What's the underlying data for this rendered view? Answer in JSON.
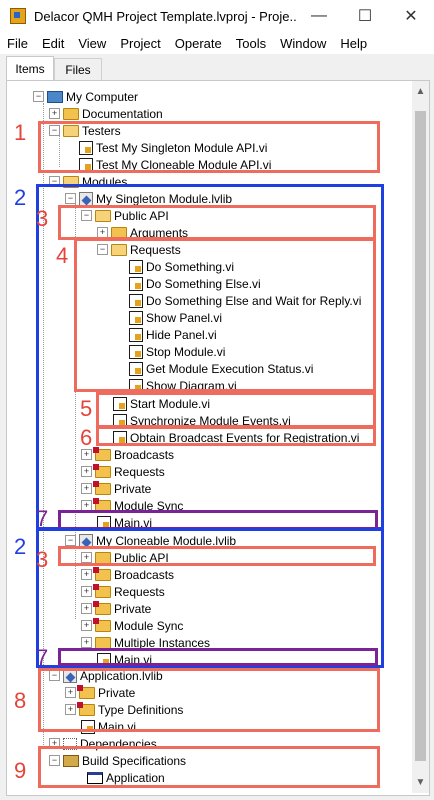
{
  "window": {
    "title": "Delacor QMH Project Template.lvproj - Proje...",
    "minimize": "—",
    "maximize": "☐",
    "close": "✕"
  },
  "menu": [
    "File",
    "Edit",
    "View",
    "Project",
    "Operate",
    "Tools",
    "Window",
    "Help"
  ],
  "tabs": {
    "items": "Items",
    "files": "Files"
  },
  "tree": {
    "my_computer": "My Computer",
    "documentation": "Documentation",
    "testers": "Testers",
    "test_singleton": "Test My Singleton Module API.vi",
    "test_cloneable": "Test My Cloneable Module API.vi",
    "modules": "Modules",
    "singleton_lib": "My Singleton Module.lvlib",
    "public_api": "Public API",
    "arguments": "Arguments",
    "requests_folder": "Requests",
    "do_something": "Do Something.vi",
    "do_something_else": "Do Something Else.vi",
    "do_something_else_wait": "Do Something Else and Wait for Reply.vi",
    "show_panel": "Show Panel.vi",
    "hide_panel": "Hide Panel.vi",
    "stop_module": "Stop Module.vi",
    "get_status": "Get Module Execution Status.vi",
    "show_diagram": "Show Diagram.vi",
    "start_module": "Start Module.vi",
    "sync_events": "Synchronize Module Events.vi",
    "obtain_broadcast": "Obtain Broadcast Events for Registration.vi",
    "broadcasts": "Broadcasts",
    "requests": "Requests",
    "private": "Private",
    "module_sync": "Module Sync",
    "main_vi": "Main.vi",
    "cloneable_lib": "My Cloneable Module.lvlib",
    "public_api2": "Public API",
    "broadcasts2": "Broadcasts",
    "requests2": "Requests",
    "private2": "Private",
    "module_sync2": "Module Sync",
    "multiple_instances": "Multiple Instances",
    "main_vi2": "Main.vi",
    "application_lib": "Application.lvlib",
    "private3": "Private",
    "type_definitions": "Type Definitions",
    "main_vi3": "Main.vi",
    "dependencies": "Dependencies",
    "build_specs": "Build Specifications",
    "application": "Application"
  },
  "annotations": [
    "1",
    "2",
    "3",
    "4",
    "5",
    "6",
    "7",
    "2",
    "3",
    "7",
    "8",
    "9"
  ],
  "colors": {
    "annotation_red": "#ee6b5e",
    "annotation_blue": "#1f3fe0",
    "annotation_purple": "#7a2396"
  }
}
